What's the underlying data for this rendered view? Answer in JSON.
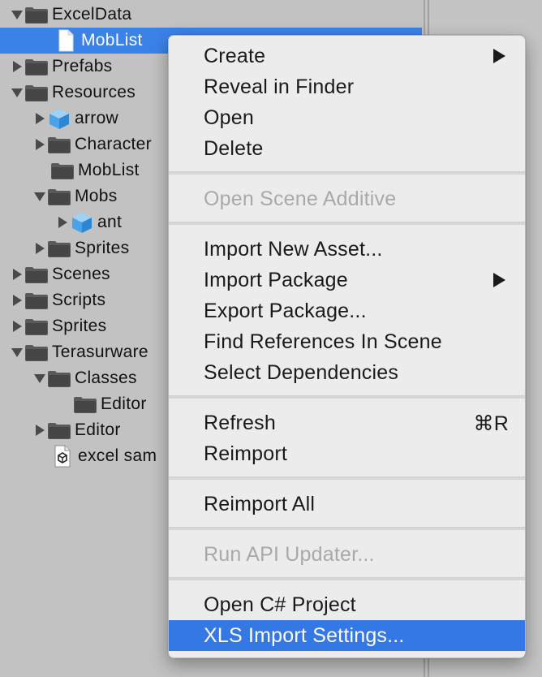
{
  "tree": {
    "items": [
      {
        "label": "ExcelData",
        "icon": "folder-icon",
        "expanded": true
      },
      {
        "label": "MobList",
        "icon": "document-icon",
        "selected": true
      },
      {
        "label": "Prefabs",
        "icon": "folder-icon",
        "expanded": false
      },
      {
        "label": "Resources",
        "icon": "folder-icon",
        "expanded": true
      },
      {
        "label": "arrow",
        "icon": "prefab-cube-icon",
        "expanded": false
      },
      {
        "label": "Character",
        "icon": "folder-icon",
        "expanded": false
      },
      {
        "label": "MobList",
        "icon": "folder-icon"
      },
      {
        "label": "Mobs",
        "icon": "folder-icon",
        "expanded": true
      },
      {
        "label": "ant",
        "icon": "prefab-cube-icon",
        "expanded": false
      },
      {
        "label": "Sprites",
        "icon": "folder-icon",
        "expanded": false
      },
      {
        "label": "Scenes",
        "icon": "folder-icon",
        "expanded": false
      },
      {
        "label": "Scripts",
        "icon": "folder-icon",
        "expanded": false
      },
      {
        "label": "Sprites",
        "icon": "folder-icon",
        "expanded": false
      },
      {
        "label": "Terasurware",
        "icon": "folder-icon",
        "expanded": true
      },
      {
        "label": "Classes",
        "icon": "folder-icon",
        "expanded": true
      },
      {
        "label": "Editor",
        "icon": "folder-icon"
      },
      {
        "label": "Editor",
        "icon": "folder-icon",
        "expanded": false
      },
      {
        "label": "excel sam",
        "icon": "unity-scene-icon"
      }
    ]
  },
  "menu": {
    "items": [
      {
        "label": "Create",
        "submenu": true
      },
      {
        "label": "Reveal in Finder"
      },
      {
        "label": "Open"
      },
      {
        "label": "Delete"
      },
      {
        "label": "Open Scene Additive",
        "disabled": true
      },
      {
        "label": "Import New Asset..."
      },
      {
        "label": "Import Package",
        "submenu": true
      },
      {
        "label": "Export Package..."
      },
      {
        "label": "Find References In Scene"
      },
      {
        "label": "Select Dependencies"
      },
      {
        "label": "Refresh",
        "shortcut": "⌘R"
      },
      {
        "label": "Reimport"
      },
      {
        "label": "Reimport All"
      },
      {
        "label": "Run API Updater...",
        "disabled": true
      },
      {
        "label": "Open C# Project"
      },
      {
        "label": "XLS Import Settings...",
        "highlighted": true
      }
    ]
  },
  "colors": {
    "selection": "#3b82e8",
    "menu_highlight": "#3478e6",
    "panel_bg": "#c2c2c2",
    "menu_bg": "#ececec",
    "disabled_text": "#a9a9a9"
  }
}
